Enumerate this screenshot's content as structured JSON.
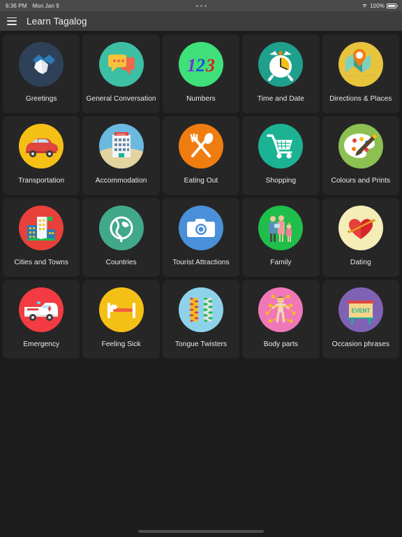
{
  "status_bar": {
    "time": "6:36 PM",
    "date": "Mon Jan 9",
    "battery_percent": "100%",
    "wifi_icon": "wifi-icon",
    "battery_icon": "battery-full-icon",
    "notch_icon": "camera-dots-icon",
    "background": "#4a4a4a"
  },
  "app_bar": {
    "menu_icon": "hamburger-menu-icon",
    "title": "Learn Tagalog",
    "background": "#3e3e3e"
  },
  "theme": {
    "page_background": "#1c1c1c",
    "card_background": "#262626",
    "label_color": "#ededed"
  },
  "grid": {
    "columns": 5,
    "items": [
      {
        "label": "Greetings",
        "icon": "handshake-icon",
        "circle_color": "#2e4158"
      },
      {
        "label": "General Conversation",
        "icon": "speech-bubbles-icon",
        "circle_color": "#3dbfa4"
      },
      {
        "label": "Numbers",
        "icon": "numbers-123-icon",
        "circle_color": "#3fe07a"
      },
      {
        "label": "Time and Date",
        "icon": "alarm-clock-icon",
        "circle_color": "#1ea08c"
      },
      {
        "label": "Directions & Places",
        "icon": "map-pin-icon",
        "circle_color": "#e8c33c"
      },
      {
        "label": "Transportation",
        "icon": "car-icon",
        "circle_color": "#f5c016"
      },
      {
        "label": "Accommodation",
        "icon": "hotel-building-icon",
        "circle_color": "#6cb9e0"
      },
      {
        "label": "Eating Out",
        "icon": "fork-spoon-icon",
        "circle_color": "#f07d10"
      },
      {
        "label": "Shopping",
        "icon": "shopping-cart-icon",
        "circle_color": "#1bb394"
      },
      {
        "label": "Colours and Prints",
        "icon": "paint-palette-icon",
        "circle_color": "#8cc152"
      },
      {
        "label": "Cities and Towns",
        "icon": "city-buildings-icon",
        "circle_color": "#e8403a"
      },
      {
        "label": "Countries",
        "icon": "globe-icon",
        "circle_color": "#41a88a"
      },
      {
        "label": "Tourist Attractions",
        "icon": "camera-icon",
        "circle_color": "#4a90d9"
      },
      {
        "label": "Family",
        "icon": "family-icon",
        "circle_color": "#1fbe4b"
      },
      {
        "label": "Dating",
        "icon": "heart-arrow-icon",
        "circle_color": "#f5edb8"
      },
      {
        "label": "Emergency",
        "icon": "ambulance-icon",
        "circle_color": "#f23b42"
      },
      {
        "label": "Feeling Sick",
        "icon": "hospital-bed-icon",
        "circle_color": "#f5c016"
      },
      {
        "label": "Tongue Twisters",
        "icon": "zigzag-icon",
        "circle_color": "#8ed2ea"
      },
      {
        "label": "Body parts",
        "icon": "body-figure-icon",
        "circle_color": "#f078b8"
      },
      {
        "label": "Occasion phrases",
        "icon": "event-billboard-icon",
        "circle_color": "#8062b5"
      }
    ]
  },
  "home_indicator": {
    "name": "home-indicator"
  }
}
